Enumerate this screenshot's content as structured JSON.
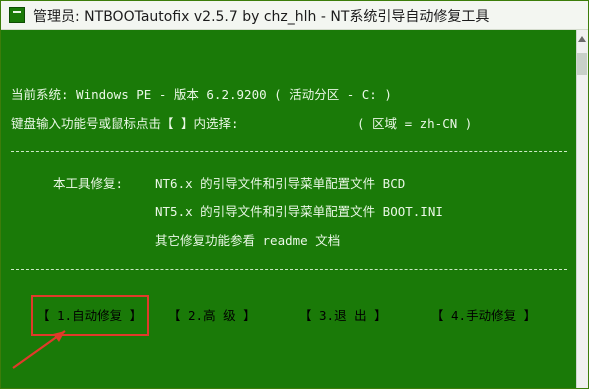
{
  "window": {
    "title": "管理员:  NTBOOTautofix v2.5.7 by chz_hlh - NT系统引导自动修复工具"
  },
  "console": {
    "current_system_line": "当前系统: Windows PE - 版本 6.2.9200   ( 活动分区 - C: )",
    "prompt_line": "键盘输入功能号或鼠标点击【 】内选择:",
    "locale_line": "( 区域 = zh-CN )",
    "tool_repair_label": "本工具修复:",
    "repair_nt6": "NT6.x 的引导文件和引导菜单配置文件 BCD",
    "repair_nt5": "NT5.x 的引导文件和引导菜单配置文件 BOOT.INI",
    "other_repair": "其它修复功能参看 readme 文档"
  },
  "menu": {
    "auto": "【 1.自动修复 】",
    "advanced": "【 2.高  级 】",
    "exit": "【 3.退  出 】",
    "manual": "【 4.手动修复 】"
  },
  "colors": {
    "console_bg": "#1a7a08",
    "console_text": "#eaf8e6",
    "highlight": "#e13a2a"
  }
}
